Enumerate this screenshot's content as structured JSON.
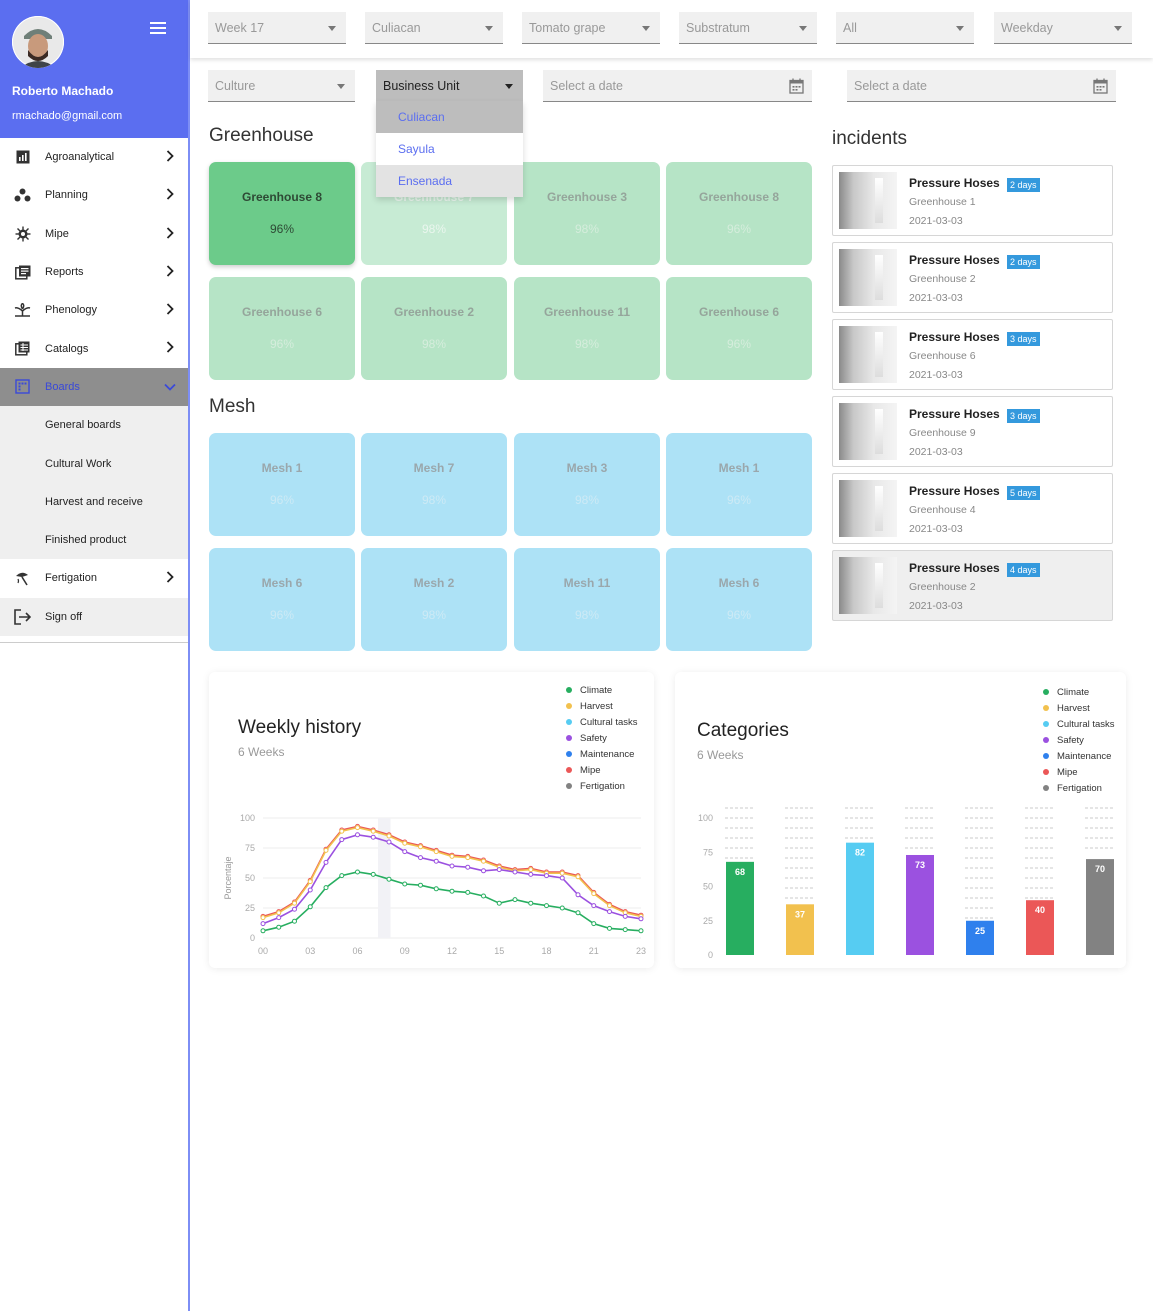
{
  "user": {
    "name": "Roberto Machado",
    "email": "rmachado@gmail.com"
  },
  "nav": {
    "items": [
      {
        "label": "Agroanalytical",
        "icon": "chart-icon"
      },
      {
        "label": "Planning",
        "icon": "planning-icon"
      },
      {
        "label": "Mipe",
        "icon": "bug-icon"
      },
      {
        "label": "Reports",
        "icon": "reports-icon"
      },
      {
        "label": "Phenology",
        "icon": "plant-icon"
      },
      {
        "label": "Catalogs",
        "icon": "catalog-icon"
      },
      {
        "label": "Boards",
        "icon": "boards-icon"
      }
    ],
    "subitems": [
      "General boards",
      "Cultural Work",
      "Harvest and receive",
      "Finished product"
    ],
    "fertigation": "Fertigation",
    "signoff": "Sign off"
  },
  "filters": {
    "row1": [
      "Week 17",
      "Culiacan",
      "Tomato grape",
      "Substratum",
      "All",
      "Weekday"
    ],
    "culture": "Culture",
    "business_unit": "Business Unit",
    "date1": "Select a date",
    "date2": "Select a date",
    "business_options": [
      "Culiacan",
      "Sayula",
      "Ensenada"
    ]
  },
  "greenhouse": {
    "title": "Greenhouse",
    "cards": [
      {
        "name": "Greenhouse 8",
        "value": "96%",
        "state": "active"
      },
      {
        "name": "Greenhouse 7",
        "value": "98%",
        "state": "faded"
      },
      {
        "name": "Greenhouse 3",
        "value": "98%",
        "state": "normal"
      },
      {
        "name": "Greenhouse 8",
        "value": "96%",
        "state": "normal"
      },
      {
        "name": "Greenhouse 6",
        "value": "96%",
        "state": "normal"
      },
      {
        "name": "Greenhouse 2",
        "value": "98%",
        "state": "normal"
      },
      {
        "name": "Greenhouse 11",
        "value": "98%",
        "state": "normal"
      },
      {
        "name": "Greenhouse 6",
        "value": "96%",
        "state": "normal"
      }
    ]
  },
  "mesh": {
    "title": "Mesh",
    "cards": [
      {
        "name": "Mesh 1",
        "value": "96%"
      },
      {
        "name": "Mesh 7",
        "value": "98%"
      },
      {
        "name": "Mesh 3",
        "value": "98%"
      },
      {
        "name": "Mesh 1",
        "value": "96%"
      },
      {
        "name": "Mesh 6",
        "value": "96%"
      },
      {
        "name": "Mesh 2",
        "value": "98%"
      },
      {
        "name": "Mesh 11",
        "value": "98%"
      },
      {
        "name": "Mesh 6",
        "value": "96%"
      }
    ]
  },
  "incidents": {
    "title": "incidents",
    "items": [
      {
        "title": "Pressure Hoses",
        "badge": "2 days",
        "location": "Greenhouse 1",
        "date": "2021-03-03"
      },
      {
        "title": "Pressure Hoses",
        "badge": "2 days",
        "location": "Greenhouse 2",
        "date": "2021-03-03"
      },
      {
        "title": "Pressure Hoses",
        "badge": "3 days",
        "location": "Greenhouse 6",
        "date": "2021-03-03"
      },
      {
        "title": "Pressure Hoses",
        "badge": "3 days",
        "location": "Greenhouse 9",
        "date": "2021-03-03"
      },
      {
        "title": "Pressure Hoses",
        "badge": "5 days",
        "location": "Greenhouse 4",
        "date": "2021-03-03"
      },
      {
        "title": "Pressure Hoses",
        "badge": "4 days",
        "location": "Greenhouse 2",
        "date": "2021-03-03"
      }
    ]
  },
  "legend": [
    {
      "name": "Climate",
      "color": "#27ae60"
    },
    {
      "name": "Harvest",
      "color": "#f2c14e"
    },
    {
      "name": "Cultural tasks",
      "color": "#56ccf2"
    },
    {
      "name": "Safety",
      "color": "#9b51e0"
    },
    {
      "name": "Maintenance",
      "color": "#2f80ed"
    },
    {
      "name": "Mipe",
      "color": "#eb5757"
    },
    {
      "name": "Fertigation",
      "color": "#828282"
    }
  ],
  "chart_data": [
    {
      "type": "line",
      "title": "Weekly history",
      "subtitle": "6 Weeks",
      "ylabel": "Porcentaje",
      "xlabel": "",
      "x_ticks": [
        "00",
        "03",
        "06",
        "09",
        "12",
        "15",
        "18",
        "21",
        "23"
      ],
      "y_ticks": [
        0,
        25,
        50,
        75,
        100
      ],
      "ylim": [
        0,
        100
      ],
      "x": [
        0,
        1,
        2,
        3,
        4,
        5,
        6,
        7,
        8,
        9,
        10,
        11,
        12,
        13,
        14,
        15,
        16,
        17,
        18,
        19,
        20,
        21,
        22,
        23,
        24
      ],
      "series": [
        {
          "name": "Mipe",
          "color": "#eb5757",
          "values": [
            18,
            22,
            30,
            48,
            74,
            90,
            93,
            90,
            86,
            80,
            77,
            73,
            69,
            68,
            65,
            60,
            57,
            58,
            55,
            55,
            52,
            38,
            28,
            22,
            19
          ]
        },
        {
          "name": "Harvest",
          "color": "#f2c14e",
          "values": [
            17,
            21,
            29,
            47,
            73,
            89,
            92,
            89,
            85,
            79,
            76,
            72,
            68,
            67,
            64,
            59,
            56,
            57,
            54,
            54,
            51,
            37,
            27,
            21,
            18
          ]
        },
        {
          "name": "Safety",
          "color": "#9b51e0",
          "values": [
            12,
            17,
            24,
            40,
            63,
            82,
            86,
            84,
            80,
            72,
            67,
            64,
            60,
            59,
            56,
            57,
            55,
            53,
            52,
            50,
            36,
            27,
            22,
            18,
            16
          ]
        },
        {
          "name": "Climate",
          "color": "#27ae60",
          "values": [
            6,
            9,
            14,
            26,
            42,
            52,
            55,
            53,
            49,
            45,
            44,
            41,
            39,
            38,
            35,
            29,
            32,
            29,
            27,
            25,
            21,
            12,
            8,
            7,
            6
          ]
        }
      ]
    },
    {
      "type": "bar",
      "title": "Categories",
      "subtitle": "6 Weeks",
      "xlabel": "",
      "ylabel": "",
      "ylim": [
        0,
        100
      ],
      "y_ticks": [
        0,
        25,
        50,
        75,
        100
      ],
      "categories": [
        "Climate",
        "Harvest",
        "Cultural tasks",
        "Safety",
        "Maintenance",
        "Mipe",
        "Fertigation"
      ],
      "values": [
        68,
        37,
        82,
        73,
        25,
        40,
        70
      ],
      "colors": [
        "#27ae60",
        "#f2c14e",
        "#56ccf2",
        "#9b51e0",
        "#2f80ed",
        "#eb5757",
        "#828282"
      ]
    }
  ]
}
